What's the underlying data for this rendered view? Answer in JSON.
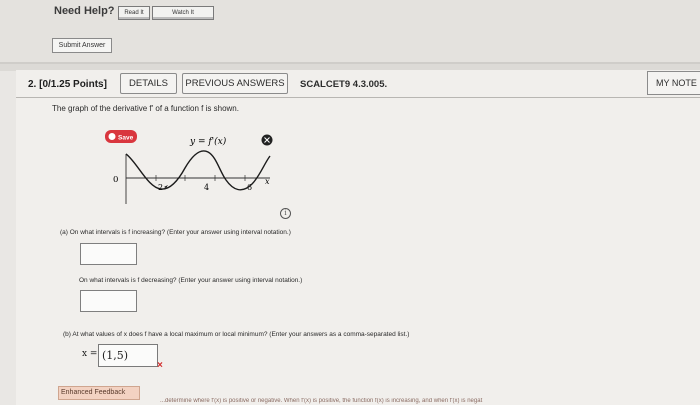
{
  "header": {
    "need_help": "Need Help?",
    "read_label": "Read It",
    "watch_label": "Watch It",
    "submit_label": "Submit Answer"
  },
  "question": {
    "label": "2. [0/1.25 Points]",
    "details_tab": "DETAILS",
    "prev_tab": "PREVIOUS ANSWERS",
    "code": "SCALCET9 4.3.005.",
    "notes_tab": "MY NOTE",
    "prompt": "The graph of the derivative f' of a function f is shown."
  },
  "graph": {
    "save_label": "Save",
    "curve_label": "y = f'(x)",
    "x_tick_labels": [
      "0",
      "2",
      "4",
      "6",
      "x"
    ]
  },
  "parts": {
    "a1": "(a)  On what intervals is f increasing? (Enter your answer using interval notation.)",
    "a2": "On what intervals is f decreasing? (Enter your answer using interval notation.)",
    "b": "(b)  At what values of x does f have a local maximum or local minimum? (Enter your answers as a comma-separated list.)",
    "x_eq": "x =",
    "b_value": "(1,5)",
    "wrong_mark": "×"
  },
  "feedback": {
    "label": "Enhanced Feedback",
    "text": "...determine where f'(x) is positive or negative. When f'(x) is positive, the function f(x) is increasing, and when f'(x) is negat"
  },
  "colors": {
    "wrong": "#d22d2d",
    "save_badge": "#d9363e"
  }
}
